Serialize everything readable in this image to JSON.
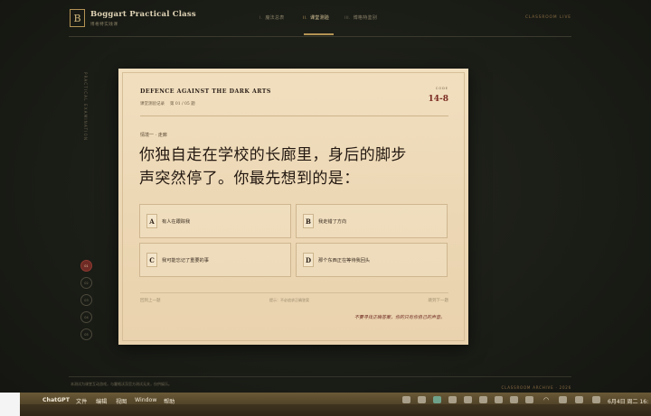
{
  "header": {
    "logo_letter": "B",
    "brand_title": "Boggart Practical Class",
    "brand_subtitle": "博格特实践课",
    "nav": [
      {
        "num": "I.",
        "label": "魔法总表"
      },
      {
        "num": "II.",
        "label": "课堂测验"
      },
      {
        "num": "III.",
        "label": "博格特鉴别"
      }
    ],
    "right": [
      "CLASSROOM",
      "LIVE"
    ]
  },
  "side": {
    "vertical_text": "PRACTICAL EXAMINATION",
    "dots": [
      "01",
      "02",
      "03",
      "04",
      "05"
    ]
  },
  "card": {
    "subject": "DEFENCE AGAINST THE DARK ARTS",
    "record_label": "课堂测验记录",
    "record_count": "第 01 / 05 题",
    "code_label": "CODE",
    "code_value": "14-8",
    "scenario": "情境一 · 走廊",
    "question": "你独自走在学校的长廊里，身后的脚步声突然停了。你最先想到的是：",
    "options": [
      {
        "letter": "A",
        "text": "有人在跟踪我"
      },
      {
        "letter": "B",
        "text": "我走错了方向"
      },
      {
        "letter": "C",
        "text": "我可能忘记了重要的事"
      },
      {
        "letter": "D",
        "text": "那个东西正在等待我回头"
      }
    ],
    "prev": "回到上一题",
    "hint": "提示：不必追求正确答案",
    "next": "跳到下一题",
    "note": "不要寻找正确答案，你的只有你自己的声音。"
  },
  "footer": {
    "left": "本测试为课堂互动游戏，与霍格沃茨官方测试无关，仅供娱乐。",
    "right": "CLASSROOM ARCHIVE · 2026"
  },
  "menubar": {
    "apple": "",
    "items": [
      "ChatGPT",
      "文件",
      "编辑",
      "视图",
      "Window",
      "帮助"
    ],
    "clock": "6月4日 周二 16:"
  }
}
